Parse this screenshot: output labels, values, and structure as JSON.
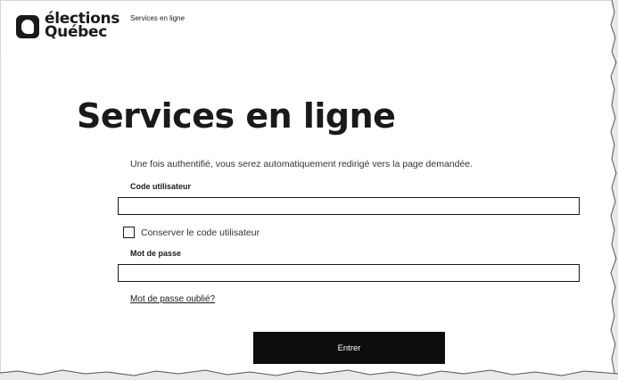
{
  "header": {
    "logo_line1": "élections",
    "logo_line2": "Québec",
    "nav_link": "Services en ligne"
  },
  "main": {
    "title": "Services en ligne",
    "intro": "Une fois authentifié, vous serez automatiquement redirigé vers la page demandée."
  },
  "form": {
    "user_code_label": "Code utilisateur",
    "user_code_value": "",
    "remember_label": "Conserver le code utilisateur",
    "remember_checked": false,
    "password_label": "Mot de passe",
    "password_value": "",
    "forgot_link": "Mot de passe oublié?",
    "submit_label": "Entrer"
  },
  "colors": {
    "text": "#1a1a1a",
    "button": "#0d0d0d",
    "button_text": "#ffffff",
    "background": "#ffffff"
  }
}
